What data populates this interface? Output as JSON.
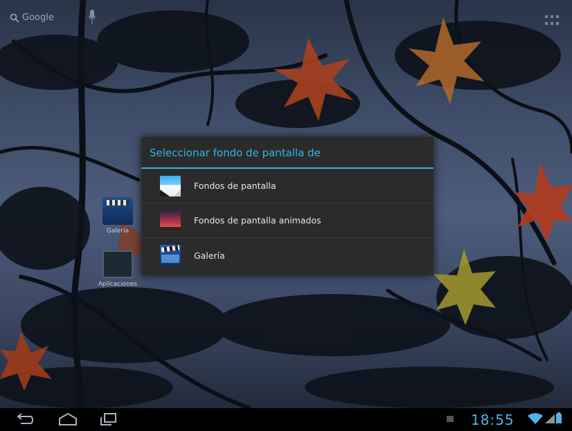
{
  "home": {
    "search_label": "Google",
    "shortcuts": [
      {
        "label": "Galería"
      },
      {
        "label": "Aplicaciones"
      }
    ]
  },
  "dialog": {
    "title": "Seleccionar fondo de pantalla de",
    "options": [
      {
        "label": "Fondos de pantalla",
        "icon": "wallpapers-icon"
      },
      {
        "label": "Fondos de pantalla animados",
        "icon": "live-wallpapers-icon"
      },
      {
        "label": "Galería",
        "icon": "gallery-icon"
      }
    ]
  },
  "status_bar": {
    "time": "18:55"
  },
  "colors": {
    "accent": "#33b5e5",
    "dialog_bg": "#2b2b2b",
    "clock": "#4fb3e9"
  }
}
